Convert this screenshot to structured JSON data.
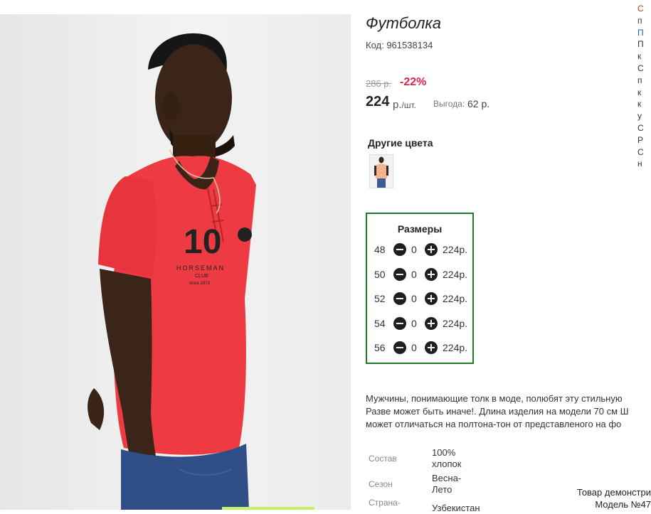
{
  "product": {
    "title": "Футболка",
    "code": "Код: 961538134",
    "old_price": "286 р.",
    "discount": "-22%",
    "price": "224",
    "currency": "р.",
    "unit": "/шт.",
    "benefit_label": "Выгода:",
    "benefit_value": "62 р."
  },
  "other_colors": {
    "title": "Другие цвета"
  },
  "sizes": {
    "title": "Размеры",
    "rows": [
      {
        "size": "48",
        "qty": "0",
        "price": "224р."
      },
      {
        "size": "50",
        "qty": "0",
        "price": "224р."
      },
      {
        "size": "52",
        "qty": "0",
        "price": "224р."
      },
      {
        "size": "54",
        "qty": "0",
        "price": "224р."
      },
      {
        "size": "56",
        "qty": "0",
        "price": "224р."
      }
    ]
  },
  "description": {
    "line1": "Мужчины, понимающие толк в моде, полюбят эту стильную",
    "line2": "Разве может быть иначе!. Длина изделия на модели 70 см Ш",
    "line3": "может отличаться на полтона-тон от представленого на фо"
  },
  "specs": {
    "composition_label": "Состав",
    "composition_value_1": "100%",
    "composition_value_2": "хлопок",
    "season_label": "Сезон",
    "season_value_1": "Весна-",
    "season_value_2": "Лето",
    "country_label": "Страна-",
    "country_value": "Узбекистан"
  },
  "side_column": [
    "С",
    "п",
    "П",
    "П",
    "к",
    "С",
    "п",
    "к",
    "к",
    "у",
    "С",
    "Р",
    "С",
    "н"
  ],
  "notice": {
    "line1": "Товар демонстри",
    "line2": "Модель №47"
  },
  "colors": {
    "accent_green": "#1e7d22",
    "discount_red": "#e0234b",
    "shirt_red": "#ee3b43"
  }
}
